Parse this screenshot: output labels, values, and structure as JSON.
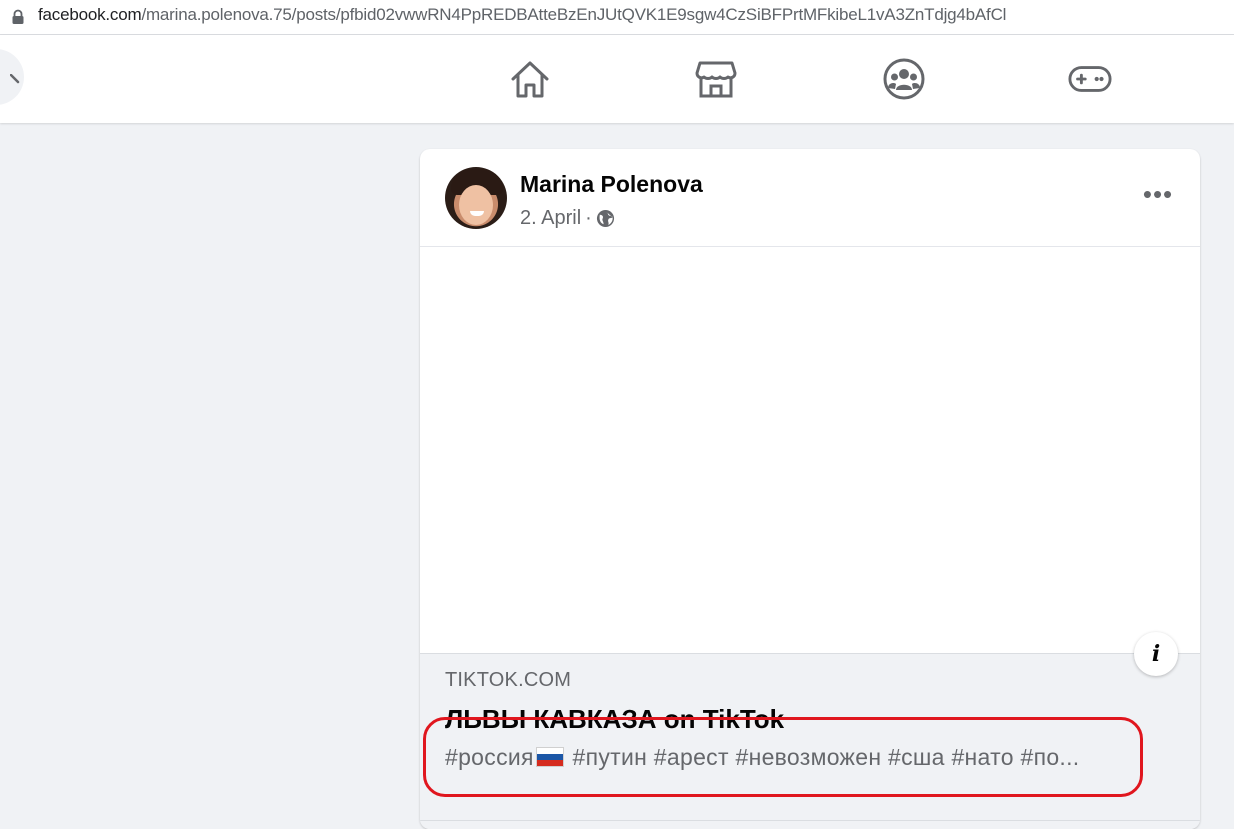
{
  "browser": {
    "url_host": "facebook.com",
    "url_path": "/marina.polenova.75/posts/pfbid02vwwRN4PpREDBAtteBzEnJUtQVK1E9sgw4CzSiBFPrtMFkibeL1vA3ZnTdjg4bAfCl"
  },
  "nav": {
    "icons": [
      "home-icon",
      "marketplace-icon",
      "groups-icon",
      "gaming-icon"
    ]
  },
  "post": {
    "author": "Marina Polenova",
    "date": "2. April",
    "separator": "·",
    "more_label": "•••",
    "info_label": "i",
    "link_preview": {
      "domain": "TIKTOK.COM",
      "title": "ЛЬВЫ КАВКАЗА on TikTok",
      "desc_part1": "#россия",
      "desc_part2": " #путин #арест #невозможен #сша #нато #по..."
    }
  },
  "colors": {
    "highlight": "#e0161e",
    "page_bg": "#f0f2f5",
    "secondary_text": "#65676b"
  }
}
